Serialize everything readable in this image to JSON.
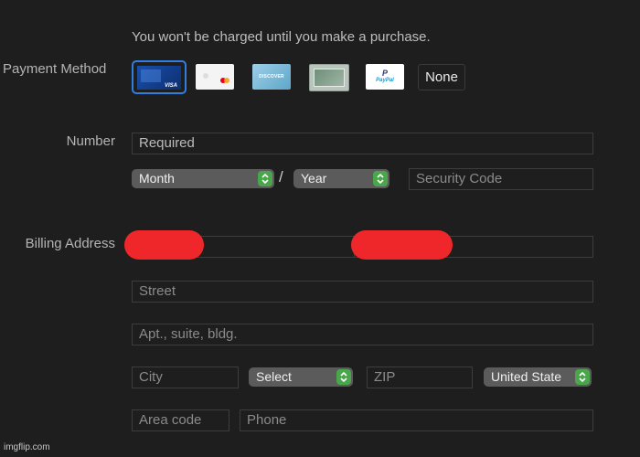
{
  "notice": "You won't be charged until you make a purchase.",
  "labels": {
    "payment_method": "Payment Method",
    "number": "Number",
    "billing_address": "Billing Address"
  },
  "payment_methods": [
    {
      "name": "Visa",
      "text": "VISA",
      "selected": true
    },
    {
      "name": "Apple Card",
      "text": ""
    },
    {
      "name": "Discover",
      "text": "DISCOVER"
    },
    {
      "name": "American Express",
      "text": ""
    },
    {
      "name": "PayPal",
      "text": "PayPal"
    }
  ],
  "none_label": "None",
  "number_field": {
    "placeholder": "Required"
  },
  "expiry": {
    "month": "Month",
    "separator": "/",
    "year": "Year"
  },
  "security_code": {
    "placeholder": "Security Code"
  },
  "address": {
    "street": "Street",
    "apt": "Apt., suite, bldg.",
    "city": "City",
    "state_select": "Select",
    "zip": "ZIP",
    "country_select": "United State",
    "area_code": "Area code",
    "phone": "Phone"
  },
  "colors": {
    "background": "#1e1e1e",
    "selected_border": "#2f7fe0",
    "stepper": "#4aa64a",
    "redaction": "#f0272a"
  },
  "watermark": "imgflip.com"
}
